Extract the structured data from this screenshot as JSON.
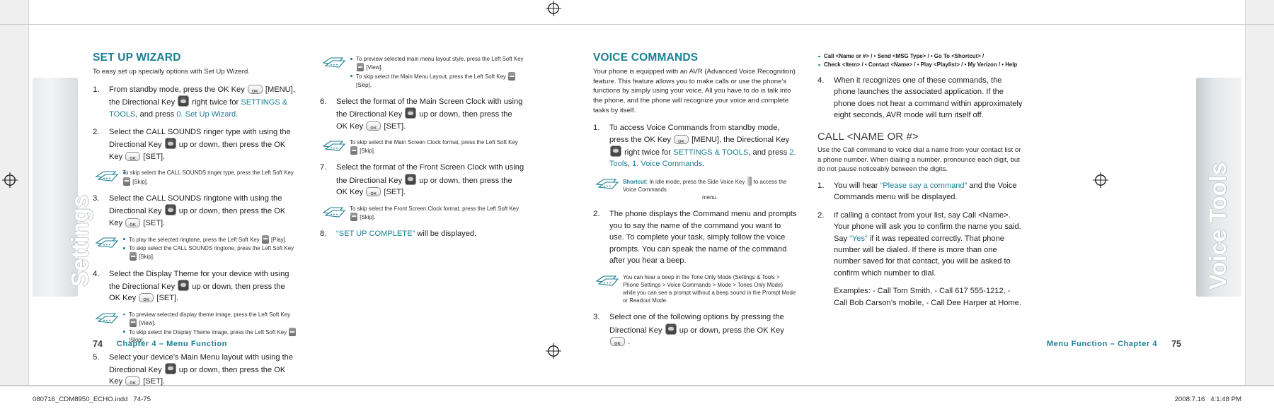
{
  "document": {
    "left_tab_label": "Settings",
    "right_tab_label": "Voice Tools"
  },
  "left_page": {
    "number": "74",
    "running_head": "Chapter 4 – Menu Function",
    "section": {
      "title": "SET UP WIZARD",
      "intro": "To easy set up specially options with Set Up Wizerd."
    },
    "steps": [
      {
        "num": "1.",
        "pre": "From standby mode, press the OK Key ",
        "mid": " [MENU], the Directional Key ",
        "post": " right twice for ",
        "link1": "SETTINGS & TOOLS",
        "between": ", and press ",
        "link2": "0. Set Up Wizard",
        "end": "."
      },
      {
        "num": "2.",
        "pre": "Select the CALL SOUNDS ringer type with using the Directional Key ",
        "mid": " up or down, then press the OK Key ",
        "post": " [SET]."
      },
      {
        "num": "3.",
        "pre": "Select the CALL SOUNDS ringtone with using the Directional Key ",
        "mid": " up or down, then press the OK Key ",
        "post": " [SET]."
      },
      {
        "num": "4.",
        "pre": "Select the Display Theme for your device with using the Directional Key ",
        "mid": " up or down, then press the OK Key ",
        "post": " [SET]."
      },
      {
        "num": "5.",
        "pre": "Select your device’s Main Menu layout with using the Directional Key ",
        "mid": " up or down, then press the OK Key ",
        "post": " [SET]."
      }
    ],
    "note_after_2": [
      {
        "pre": "To skip select the CALL SOUNDS ringer type, press the Left Soft Key ",
        "post": " [Skip]."
      }
    ],
    "note_after_3": [
      {
        "pre": "To play the selected ringtone, press the Left Soft Key ",
        "post": " [Play]."
      },
      {
        "pre": "To skip select the CALL SOUNDS ringtone, press the Left Soft Key ",
        "post": " [Skip]."
      }
    ],
    "note_after_4": [
      {
        "pre": "To preview selected display theme image, press the Left Soft Key ",
        "post": " [View]."
      },
      {
        "pre": "To skip select the Display Theme image, press the Left Soft Key ",
        "post": " [Skip]."
      }
    ],
    "col2_note_top": [
      {
        "pre": "To preview selected main menu layout style, press the Left Soft Key ",
        "post": " [View]."
      },
      {
        "pre": "To skip select the Main Menu Layout, press the Left Soft Key ",
        "post": " [Skip]."
      }
    ],
    "steps_col2": [
      {
        "num": "6.",
        "pre": "Select the format of the Main Screen Clock with using the Directional Key ",
        "mid": " up or down, then press the OK Key ",
        "post": " [SET]."
      },
      {
        "num": "7.",
        "pre": "Select the format of the Front Screen Clock with using the Directional Key ",
        "mid": " up or down, then press the OK Key ",
        "post": " [SET]."
      }
    ],
    "note_after_6": {
      "pre": "To skip select the Main Screen Clock format, press the Left Soft Key ",
      "post": " [Skip]."
    },
    "note_after_7": {
      "pre": "To skip select the Front Screen Clock format, press the Left Soft Key ",
      "post": " [Skip]."
    },
    "step8": {
      "num": "8.",
      "quoted": "“SET UP COMPLETE”",
      "rest": " will be displayed."
    }
  },
  "right_page": {
    "number": "75",
    "running_head": "Menu Function – Chapter 4",
    "section": {
      "title": "VOICE COMMANDS",
      "intro": "Your phone is equipped with an AVR (Advanced Voice Recognition) feature. This feature allows you to make calls or use the phone’s functions by simply using your voice. All you have to do is talk into the phone, and the phone will recognize your voice and complete tasks by itself."
    },
    "steps": [
      {
        "num": "1.",
        "pre": "To access Voice Commands from standby mode, press the OK Key ",
        "mid": " [MENU], the Directional Key ",
        "post": " right twice for ",
        "link1": "SETTINGS & TOOLS",
        "between": ", and press ",
        "link2": "2. Tools",
        "between2": ", ",
        "link3": "1. Voice Commands",
        "end": "."
      },
      {
        "num": "2.",
        "text": "The phone displays the Command menu and prompts you to say the name of the command you want to use. To complete your task, simply follow the voice prompts. You can speak the name of the command after you hear a beep."
      },
      {
        "num": "3.",
        "pre": "Select one of the following options by pressing the Directional Key ",
        "mid": " up or down, press the OK Key ",
        "post": " ."
      }
    ],
    "note_shortcut": {
      "label": "Shortcut:",
      "pre": " In idle mode, press the Side Voice Key ",
      "post": " to access the Voice Commands",
      "line2": "menu."
    },
    "note_beep": "You can hear a beep in the Tone Only Mode (Settings & Tools > Phone Settings > Voice Commands > Mode > Tones Only Mode) while you can see a prompt without a beep sound in the Prompt Mode or Readout Mode.",
    "command_list": [
      "Call <Name or #> / • Send <MSG Type> / • Go To  <Shortcut> /",
      "Check <Item> / • Contact <Name> / • Play <Playlist> / • My Verizon / • Help"
    ],
    "step4": {
      "num": "4.",
      "text": "When it recognizes one of these commands, the phone launches the associated application. If the phone does not hear a command within approximately eight seconds, AVR mode will turn itself off."
    },
    "subsection": {
      "title": "CALL <NAME OR #>",
      "intro": "Use the Call command to voice dial a name from your contact list or a phone number. When dialing a number, pronounce each digit, but do not pause noticeably between the digits."
    },
    "sub_steps": [
      {
        "num": "1.",
        "pre": "You will hear ",
        "quoted": "“Please say a command”",
        "post": " and the Voice Commands menu will be displayed."
      },
      {
        "num": "2.",
        "pre": "If calling a contact from your list, say Call <Name>. Your phone will ask you to confirm the name you said. Say ",
        "quoted": "“Yes”",
        "post": " if it was repeated correctly. That phone number will be dialed. If there is more than one number saved for that contact, you will be asked to confirm which number to dial."
      }
    ],
    "examples": "Examples: - Call Tom Smith, - Call 617 555-1212, - Call Bob Carson’s mobile, - Call Dee Harper at Home."
  },
  "print_slug": {
    "left": "080716_CDM8950_ECHO.indd   74-75",
    "right": "2008.7.16   4:1:48 PM"
  },
  "colors": {
    "accent": "#1b7f95",
    "text": "#231f20"
  }
}
